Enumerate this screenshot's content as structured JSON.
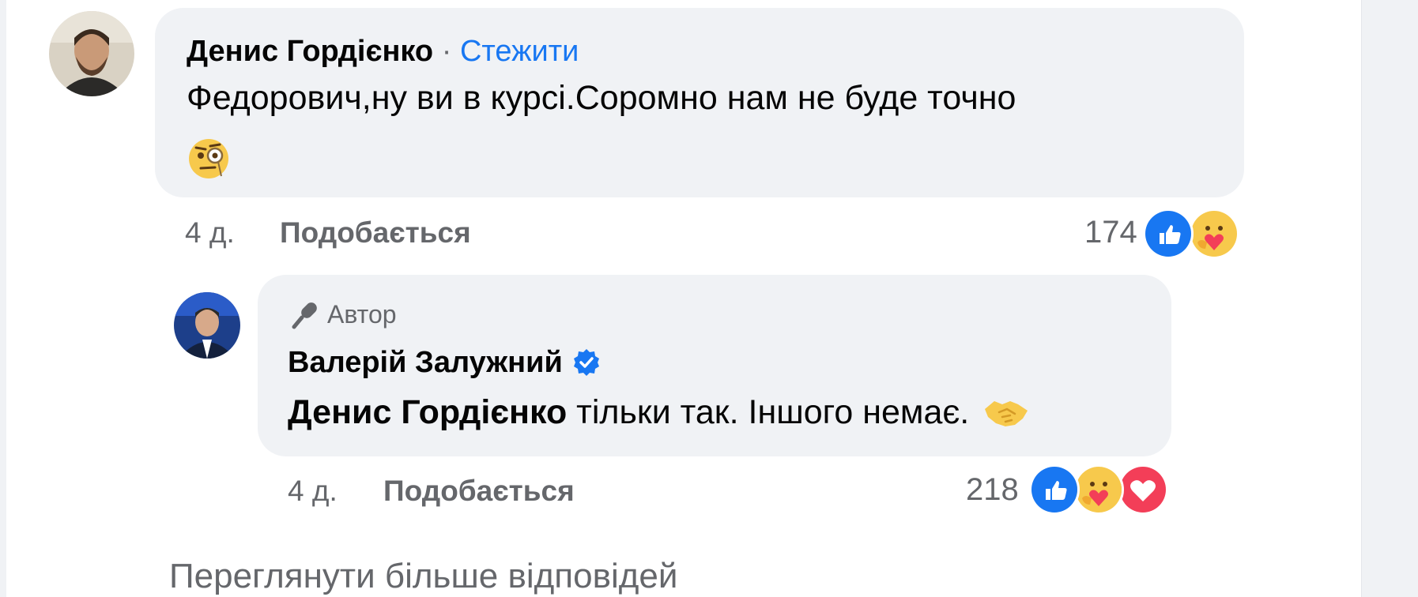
{
  "comment": {
    "author": "Денис Гордієнко",
    "separator": "·",
    "follow_label": "Стежити",
    "text": "Федорович,ну ви в курсі.Соромно нам не буде точно",
    "age": "4 д.",
    "like_label": "Подобається",
    "reaction_count": "174",
    "reactions": [
      "like-icon",
      "care-icon"
    ]
  },
  "reply": {
    "badge": "Автор",
    "author": "Валерій Залужний",
    "verified": true,
    "mention": "Денис Гордієнко",
    "text": " тільки так. Іншого немає.",
    "age": "4 д.",
    "like_label": "Подобається",
    "reaction_count": "218",
    "reactions": [
      "like-icon",
      "care-icon",
      "love-icon"
    ]
  },
  "more_replies_label": "Переглянути більше відповідей",
  "colors": {
    "link": "#1877f2",
    "meta": "#65676b",
    "bubble": "#f0f2f5",
    "text": "#050505",
    "love": "#f33e58"
  }
}
